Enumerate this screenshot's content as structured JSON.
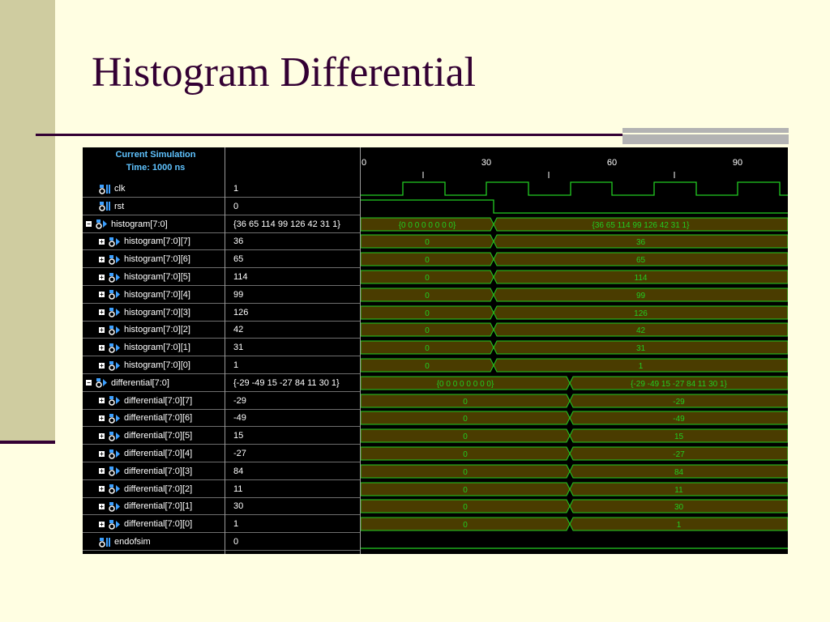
{
  "slide": {
    "title": "Histogram Differential"
  },
  "header": {
    "line1": "Current Simulation",
    "line2": "Time: 1000 ns"
  },
  "timeline": {
    "ticks": [
      "0",
      "30",
      "60",
      "90"
    ]
  },
  "signals": [
    {
      "name": "clk",
      "value": "1",
      "kind": "clock",
      "icon": "bit-signal-icon"
    },
    {
      "name": "rst",
      "value": "0",
      "kind": "step",
      "icon": "bit-signal-icon"
    },
    {
      "name": "histogram[7:0]",
      "value": "{36 65 114 99 126 42 31 1}",
      "kind": "bus",
      "expander": "−",
      "icon": "bus-signal-icon",
      "before": "{0 0 0 0 0 0 0 0}",
      "after": "{36 65 114 99 126 42 31 1}",
      "switch": 164
    },
    {
      "name": "histogram[7:0][7]",
      "value": "36",
      "kind": "bus",
      "expander": "+",
      "icon": "bus-signal-icon",
      "indent": true,
      "before": "0",
      "after": "36",
      "switch": 164
    },
    {
      "name": "histogram[7:0][6]",
      "value": "65",
      "kind": "bus",
      "expander": "+",
      "icon": "bus-signal-icon",
      "indent": true,
      "before": "0",
      "after": "65",
      "switch": 164
    },
    {
      "name": "histogram[7:0][5]",
      "value": "114",
      "kind": "bus",
      "expander": "+",
      "icon": "bus-signal-icon",
      "indent": true,
      "before": "0",
      "after": "114",
      "switch": 164
    },
    {
      "name": "histogram[7:0][4]",
      "value": "99",
      "kind": "bus",
      "expander": "+",
      "icon": "bus-signal-icon",
      "indent": true,
      "before": "0",
      "after": "99",
      "switch": 164
    },
    {
      "name": "histogram[7:0][3]",
      "value": "126",
      "kind": "bus",
      "expander": "+",
      "icon": "bus-signal-icon",
      "indent": true,
      "before": "0",
      "after": "126",
      "switch": 164
    },
    {
      "name": "histogram[7:0][2]",
      "value": "42",
      "kind": "bus",
      "expander": "+",
      "icon": "bus-signal-icon",
      "indent": true,
      "before": "0",
      "after": "42",
      "switch": 164
    },
    {
      "name": "histogram[7:0][1]",
      "value": "31",
      "kind": "bus",
      "expander": "+",
      "icon": "bus-signal-icon",
      "indent": true,
      "before": "0",
      "after": "31",
      "switch": 164
    },
    {
      "name": "histogram[7:0][0]",
      "value": "1",
      "kind": "bus",
      "expander": "+",
      "icon": "bus-signal-icon",
      "indent": true,
      "before": "0",
      "after": "1",
      "switch": 164
    },
    {
      "name": "differential[7:0]",
      "value": "{-29 -49 15 -27 84 11 30 1}",
      "kind": "bus",
      "expander": "−",
      "icon": "bus-signal-icon",
      "before": "{0 0 0 0 0 0 0 0}",
      "after": "{-29 -49 15 -27 84 11 30 1}",
      "switch": 258
    },
    {
      "name": "differential[7:0][7]",
      "value": "-29",
      "kind": "bus",
      "expander": "+",
      "icon": "bus-signal-icon",
      "indent": true,
      "before": "0",
      "after": "-29",
      "switch": 258
    },
    {
      "name": "differential[7:0][6]",
      "value": "-49",
      "kind": "bus",
      "expander": "+",
      "icon": "bus-signal-icon",
      "indent": true,
      "before": "0",
      "after": "-49",
      "switch": 258
    },
    {
      "name": "differential[7:0][5]",
      "value": "15",
      "kind": "bus",
      "expander": "+",
      "icon": "bus-signal-icon",
      "indent": true,
      "before": "0",
      "after": "15",
      "switch": 258
    },
    {
      "name": "differential[7:0][4]",
      "value": "-27",
      "kind": "bus",
      "expander": "+",
      "icon": "bus-signal-icon",
      "indent": true,
      "before": "0",
      "after": "-27",
      "switch": 258
    },
    {
      "name": "differential[7:0][3]",
      "value": "84",
      "kind": "bus",
      "expander": "+",
      "icon": "bus-signal-icon",
      "indent": true,
      "before": "0",
      "after": "84",
      "switch": 258
    },
    {
      "name": "differential[7:0][2]",
      "value": "11",
      "kind": "bus",
      "expander": "+",
      "icon": "bus-signal-icon",
      "indent": true,
      "before": "0",
      "after": "11",
      "switch": 258
    },
    {
      "name": "differential[7:0][1]",
      "value": "30",
      "kind": "bus",
      "expander": "+",
      "icon": "bus-signal-icon",
      "indent": true,
      "before": "0",
      "after": "30",
      "switch": 258
    },
    {
      "name": "differential[7:0][0]",
      "value": "1",
      "kind": "bus",
      "expander": "+",
      "icon": "bus-signal-icon",
      "indent": true,
      "before": "0",
      "after": "1",
      "switch": 258
    },
    {
      "name": "endofsim",
      "value": "0",
      "kind": "low",
      "icon": "bit-signal-icon"
    }
  ],
  "colors": {
    "wave": "#22cc22",
    "busfill": "#4a3c00",
    "panel": "#000000",
    "header": "#5fc3ff",
    "title": "#330033"
  }
}
